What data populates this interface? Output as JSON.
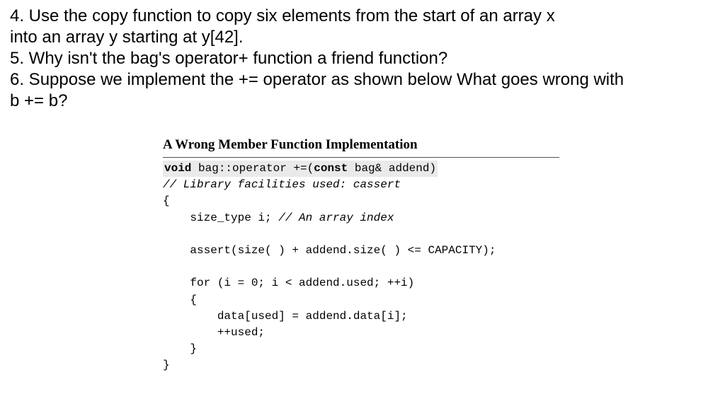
{
  "questions": {
    "q4_line1": "4. Use the copy function to copy six elements from the start of an array x",
    "q4_line2": "into an array y starting at y[42].",
    "q5": "5. Why isn't the bag's operator+ function a friend function?",
    "q6_line1": "6. Suppose we implement the += operator as shown below What goes wrong with",
    "q6_line2": "b += b?"
  },
  "code": {
    "title": "A Wrong Member Function Implementation",
    "sig_void": "void",
    "sig_mid": " bag::operator +=(",
    "sig_const": "const",
    "sig_end": " bag& addend)",
    "c1": "// Library facilities used: cassert",
    "open": "{",
    "l1a": "    size_type i; ",
    "l1b": "// An array index",
    "blank": "",
    "l2": "    assert(size( ) + addend.size( ) <= CAPACITY);",
    "l3": "    for (i = 0; i < addend.used; ++i)",
    "l4": "    {",
    "l5": "        data[used] = addend.data[i];",
    "l6": "        ++used;",
    "l7": "    }",
    "close": "}"
  }
}
